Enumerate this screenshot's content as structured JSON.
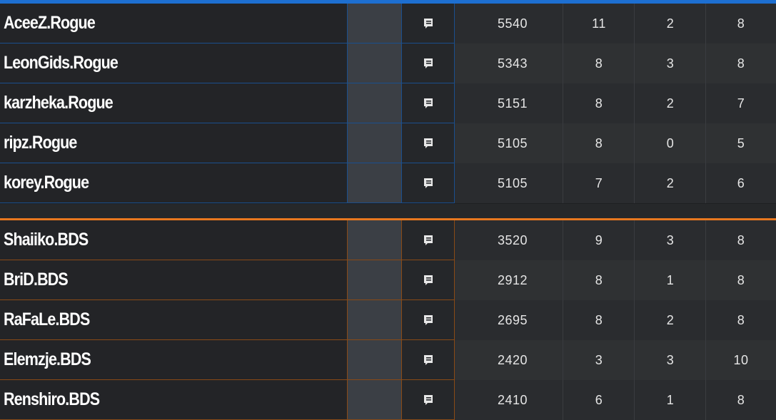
{
  "teams": [
    {
      "name": "Rogue",
      "color": "#1d6fd1",
      "players": [
        {
          "name": "AceeZ.Rogue",
          "score": "5540",
          "kills": "11",
          "deaths": "2",
          "assists": "8"
        },
        {
          "name": "LeonGids.Rogue",
          "score": "5343",
          "kills": "8",
          "deaths": "3",
          "assists": "8"
        },
        {
          "name": "karzheka.Rogue",
          "score": "5151",
          "kills": "8",
          "deaths": "2",
          "assists": "7"
        },
        {
          "name": "ripz.Rogue",
          "score": "5105",
          "kills": "8",
          "deaths": "0",
          "assists": "5"
        },
        {
          "name": "korey.Rogue",
          "score": "5105",
          "kills": "7",
          "deaths": "2",
          "assists": "6"
        }
      ]
    },
    {
      "name": "BDS",
      "color": "#e8781f",
      "players": [
        {
          "name": "Shaiiko.BDS",
          "score": "3520",
          "kills": "9",
          "deaths": "3",
          "assists": "8"
        },
        {
          "name": "BriD.BDS",
          "score": "2912",
          "kills": "8",
          "deaths": "1",
          "assists": "8"
        },
        {
          "name": "RaFaLe.BDS",
          "score": "2695",
          "kills": "8",
          "deaths": "2",
          "assists": "8"
        },
        {
          "name": "Elemzje.BDS",
          "score": "2420",
          "kills": "3",
          "deaths": "3",
          "assists": "10"
        },
        {
          "name": "Renshiro.BDS",
          "score": "2410",
          "kills": "6",
          "deaths": "1",
          "assists": "8"
        }
      ]
    }
  ],
  "icons": {
    "chat": "chat-bubble-icon"
  }
}
